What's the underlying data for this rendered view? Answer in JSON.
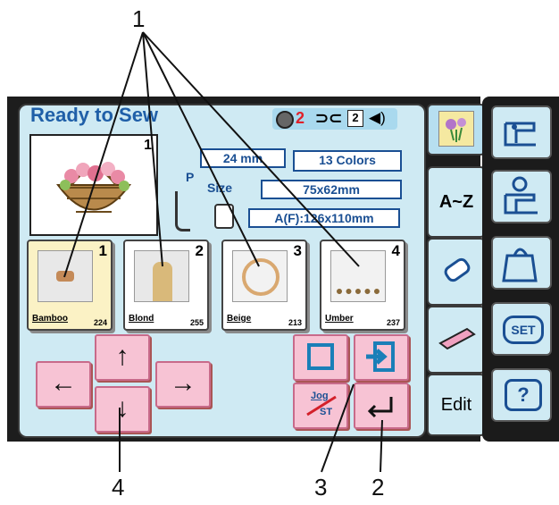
{
  "screen": {
    "title": "Ready to Sew",
    "thread_count": "2",
    "jump_count": "2",
    "height": "24 mm",
    "colors": "13 Colors",
    "size_label": "Size",
    "size": "75x62mm",
    "hoop": "A(F):126x110mm",
    "pressure_label": "P",
    "preview_index": "1"
  },
  "thumbnails": [
    {
      "index": "1",
      "name": "Bamboo",
      "code": "224"
    },
    {
      "index": "2",
      "name": "Blond",
      "code": "255"
    },
    {
      "index": "3",
      "name": "Beige",
      "code": "213"
    },
    {
      "index": "4",
      "name": "Umber",
      "code": "237"
    }
  ],
  "tabs": {
    "az": "A~Z",
    "edit": "Edit"
  },
  "buttons": {
    "up": "↑",
    "down": "↓",
    "left": "←",
    "right": "→",
    "jog_top": "Jog",
    "jog_bottom": "ST",
    "set": "SET",
    "help": "?"
  },
  "callouts": {
    "top": "1",
    "bottom_left": "4",
    "bottom_mid": "3",
    "bottom_right": "2"
  },
  "colors": {
    "screen_bg": "#cfeaf3",
    "accent_blue": "#1f5fa8",
    "pink_button": "#f7c3d4",
    "selected_thumb": "#fbf2c5"
  }
}
